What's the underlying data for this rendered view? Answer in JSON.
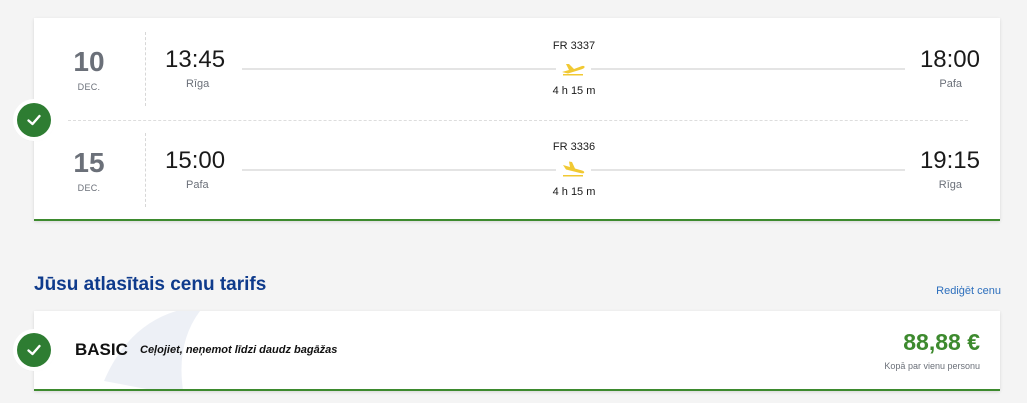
{
  "flights": [
    {
      "day": "10",
      "month": "DEC.",
      "dep_time": "13:45",
      "dep_city": "Rīga",
      "flight_no": "FR 3337",
      "duration": "4 h 15 m",
      "arr_time": "18:00",
      "arr_city": "Pafa"
    },
    {
      "day": "15",
      "month": "DEC.",
      "dep_time": "15:00",
      "dep_city": "Pafa",
      "flight_no": "FR 3336",
      "duration": "4 h 15 m",
      "arr_time": "19:15",
      "arr_city": "Rīga"
    }
  ],
  "fare_section": {
    "title": "Jūsu atlasītais cenu tarifs",
    "edit_label": "Rediģēt cenu"
  },
  "fare": {
    "name": "BASIC",
    "description": "Ceļojiet, neņemot līdzi daudz bagāžas",
    "price": "88,88 €",
    "price_note": "Kopā par vienu personu"
  },
  "colors": {
    "accent_green": "#2e7d32",
    "price_green": "#3d8a2e",
    "title_blue": "#0f3b8c",
    "link_blue": "#2d6fbd",
    "plane_yellow": "#f1c933"
  },
  "icons": {
    "selected": "check-icon",
    "outbound": "plane-takeoff-icon",
    "return": "plane-landing-icon"
  }
}
